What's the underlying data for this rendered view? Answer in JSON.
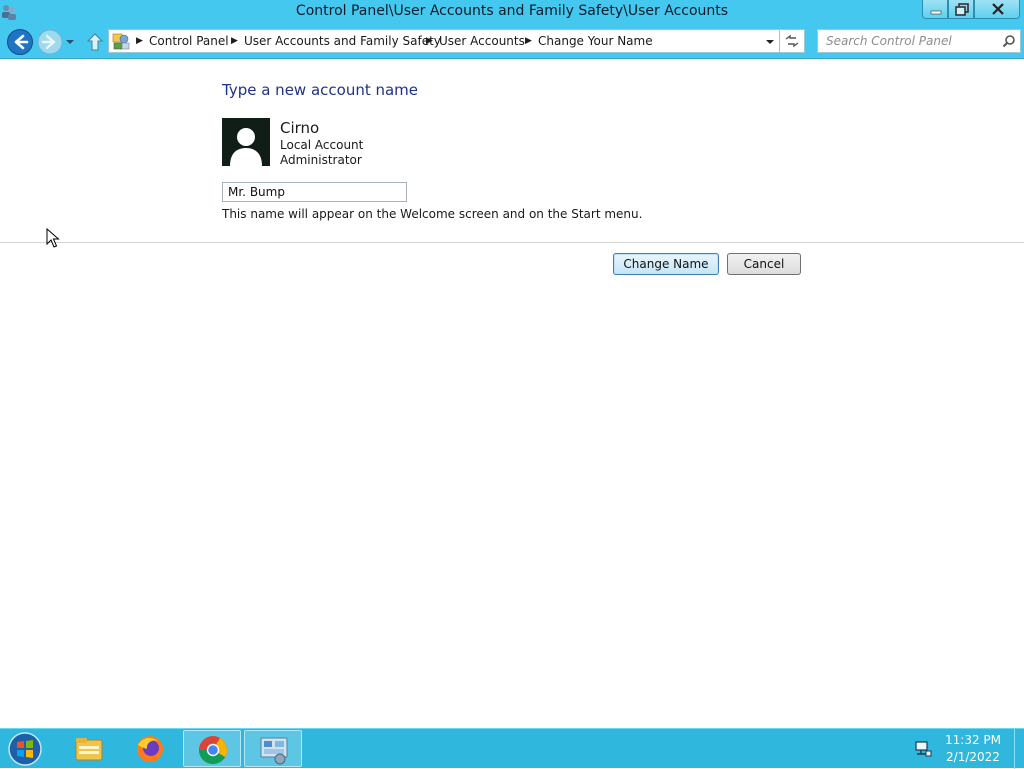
{
  "window": {
    "title": "Control Panel\\User Accounts and Family Safety\\User Accounts"
  },
  "address_bar": {
    "breadcrumbs": [
      "Control Panel",
      "User Accounts and Family Safety",
      "User Accounts",
      "Change Your Name"
    ]
  },
  "search": {
    "placeholder": "Search Control Panel"
  },
  "content": {
    "heading": "Type a new account name",
    "account": {
      "name": "Cirno",
      "type": "Local Account",
      "role": "Administrator"
    },
    "new_name_value": "Mr. Bump",
    "hint": "This name will appear on the Welcome screen and on the Start menu.",
    "change_button": "Change Name",
    "cancel_button": "Cancel"
  },
  "taskbar": {
    "items": [
      "file-explorer-icon",
      "firefox-icon",
      "chrome-icon",
      "control-panel-icon"
    ],
    "clock_time": "11:32 PM",
    "clock_date": "2/1/2022"
  },
  "colors": {
    "chrome_accent": "#44c8ef",
    "taskbar": "#2fb7dd",
    "heading_text": "#1e3287"
  }
}
